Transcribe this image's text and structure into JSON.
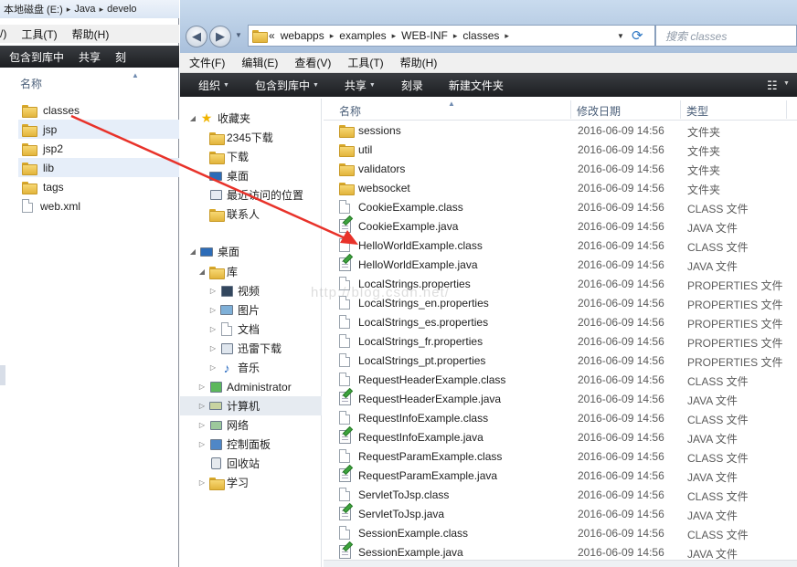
{
  "back_window": {
    "address": [
      "本地磁盘 (E:)",
      "Java",
      "develo"
    ],
    "menu": [
      "/)",
      "工具(T)",
      "帮助(H)"
    ],
    "toolbar": [
      "包含到库中",
      "共享",
      "刻"
    ],
    "column_name": "名称",
    "items": [
      {
        "name": "classes",
        "icon": "folder-icon"
      },
      {
        "name": "jsp",
        "icon": "folder-icon"
      },
      {
        "name": "jsp2",
        "icon": "folder-icon"
      },
      {
        "name": "lib",
        "icon": "folder-icon"
      },
      {
        "name": "tags",
        "icon": "folder-icon"
      },
      {
        "name": "web.xml",
        "icon": "document-icon"
      }
    ]
  },
  "front_window": {
    "address": {
      "overflow": "«",
      "crumbs": [
        "webapps",
        "examples",
        "WEB-INF",
        "classes"
      ]
    },
    "search_placeholder": "搜索 classes",
    "menu": [
      "文件(F)",
      "编辑(E)",
      "查看(V)",
      "工具(T)",
      "帮助(H)"
    ],
    "toolbar": [
      {
        "label": "组织",
        "dropdown": true
      },
      {
        "label": "包含到库中",
        "dropdown": true
      },
      {
        "label": "共享",
        "dropdown": true
      },
      {
        "label": "刻录",
        "dropdown": false
      },
      {
        "label": "新建文件夹",
        "dropdown": false
      }
    ],
    "nav": {
      "favorites": {
        "label": "收藏夹",
        "items": [
          "2345下载",
          "下载",
          "桌面",
          "最近访问的位置",
          "联系人"
        ]
      },
      "desktop": {
        "label": "桌面"
      },
      "library": {
        "label": "库",
        "items": [
          "视频",
          "图片",
          "文档",
          "迅雷下载",
          "音乐"
        ]
      },
      "others": [
        "Administrator",
        "计算机",
        "网络",
        "控制面板",
        "回收站",
        "学习"
      ]
    },
    "columns": {
      "name": "名称",
      "date": "修改日期",
      "type": "类型"
    },
    "files": [
      {
        "name": "sessions",
        "date": "2016-06-09 14:56",
        "type": "文件夹",
        "icon": "folder"
      },
      {
        "name": "util",
        "date": "2016-06-09 14:56",
        "type": "文件夹",
        "icon": "folder"
      },
      {
        "name": "validators",
        "date": "2016-06-09 14:56",
        "type": "文件夹",
        "icon": "folder"
      },
      {
        "name": "websocket",
        "date": "2016-06-09 14:56",
        "type": "文件夹",
        "icon": "folder"
      },
      {
        "name": "CookieExample.class",
        "date": "2016-06-09 14:56",
        "type": "CLASS 文件",
        "icon": "doc"
      },
      {
        "name": "CookieExample.java",
        "date": "2016-06-09 14:56",
        "type": "JAVA 文件",
        "icon": "java"
      },
      {
        "name": "HelloWorldExample.class",
        "date": "2016-06-09 14:56",
        "type": "CLASS 文件",
        "icon": "doc"
      },
      {
        "name": "HelloWorldExample.java",
        "date": "2016-06-09 14:56",
        "type": "JAVA 文件",
        "icon": "java"
      },
      {
        "name": "LocalStrings.properties",
        "date": "2016-06-09 14:56",
        "type": "PROPERTIES 文件",
        "icon": "doc"
      },
      {
        "name": "LocalStrings_en.properties",
        "date": "2016-06-09 14:56",
        "type": "PROPERTIES 文件",
        "icon": "doc"
      },
      {
        "name": "LocalStrings_es.properties",
        "date": "2016-06-09 14:56",
        "type": "PROPERTIES 文件",
        "icon": "doc"
      },
      {
        "name": "LocalStrings_fr.properties",
        "date": "2016-06-09 14:56",
        "type": "PROPERTIES 文件",
        "icon": "doc"
      },
      {
        "name": "LocalStrings_pt.properties",
        "date": "2016-06-09 14:56",
        "type": "PROPERTIES 文件",
        "icon": "doc"
      },
      {
        "name": "RequestHeaderExample.class",
        "date": "2016-06-09 14:56",
        "type": "CLASS 文件",
        "icon": "doc"
      },
      {
        "name": "RequestHeaderExample.java",
        "date": "2016-06-09 14:56",
        "type": "JAVA 文件",
        "icon": "java"
      },
      {
        "name": "RequestInfoExample.class",
        "date": "2016-06-09 14:56",
        "type": "CLASS 文件",
        "icon": "doc"
      },
      {
        "name": "RequestInfoExample.java",
        "date": "2016-06-09 14:56",
        "type": "JAVA 文件",
        "icon": "java"
      },
      {
        "name": "RequestParamExample.class",
        "date": "2016-06-09 14:56",
        "type": "CLASS 文件",
        "icon": "doc"
      },
      {
        "name": "RequestParamExample.java",
        "date": "2016-06-09 14:56",
        "type": "JAVA 文件",
        "icon": "java"
      },
      {
        "name": "ServletToJsp.class",
        "date": "2016-06-09 14:56",
        "type": "CLASS 文件",
        "icon": "doc"
      },
      {
        "name": "ServletToJsp.java",
        "date": "2016-06-09 14:56",
        "type": "JAVA 文件",
        "icon": "java"
      },
      {
        "name": "SessionExample.class",
        "date": "2016-06-09 14:56",
        "type": "CLASS 文件",
        "icon": "doc"
      },
      {
        "name": "SessionExample.java",
        "date": "2016-06-09 14:56",
        "type": "JAVA 文件",
        "icon": "java"
      }
    ]
  },
  "watermark": "http://blog.csdn.net/",
  "annotation": {
    "color": "#e8322a"
  }
}
